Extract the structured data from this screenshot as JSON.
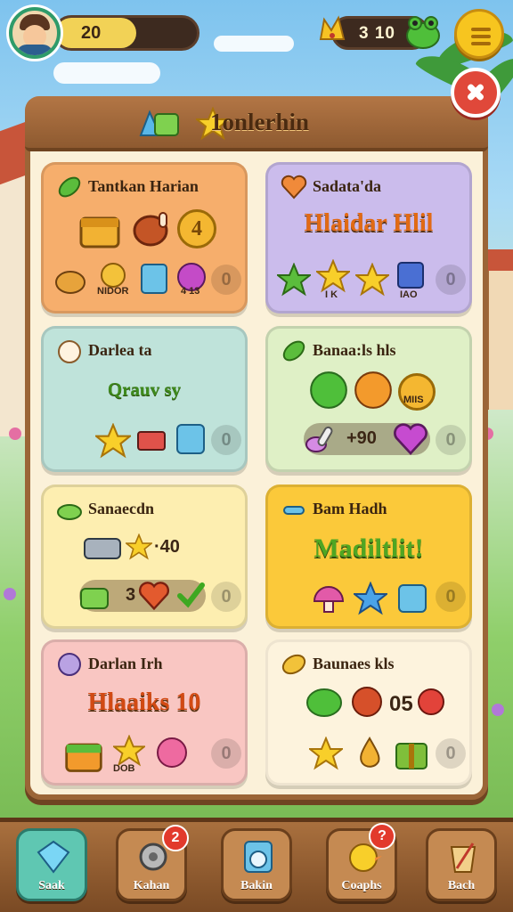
{
  "hud": {
    "level": "20",
    "coins": "3 10"
  },
  "panel": {
    "title": "1onlerhin"
  },
  "cards": [
    {
      "title": "Tantkan Harian",
      "items": [
        "NIDOR",
        "",
        "4 13"
      ],
      "value": "4",
      "slot": "0",
      "color": "#f6ae6c"
    },
    {
      "title": "Sadata'da",
      "headline": "Hlaidar Hlil",
      "items": [
        "I K",
        "",
        "IAO"
      ],
      "slot": "0",
      "color": "#cbbcec"
    },
    {
      "title": "Darlea ta",
      "subline": "Qrauv sy",
      "slot": "0",
      "color": "#bfe3da"
    },
    {
      "title": "Banaa:ls hls",
      "items": [
        "MIIS"
      ],
      "pill_value": "+90",
      "slot": "0",
      "color": "#dff0c6"
    },
    {
      "title": "Sanaecdn",
      "value": "40",
      "pill_value": "3",
      "slot": "0",
      "color": "#fdeeb0"
    },
    {
      "title": "Bam Hadh",
      "headline": "Madiltlit!",
      "slot": "0",
      "color": "#fbc93a"
    },
    {
      "title": "Darlan Irh",
      "headline": "Hlaaiks 10",
      "items": [
        "DOB"
      ],
      "slot": "0",
      "color": "#f9c6c2"
    },
    {
      "title": "Baunaes kls",
      "value": "05",
      "slot": "0",
      "color": "#fdf3dd"
    }
  ],
  "nav": [
    {
      "label": "Saak",
      "badge": ""
    },
    {
      "label": "Kahan",
      "badge": "2"
    },
    {
      "label": "Bakin",
      "badge": ""
    },
    {
      "label": "Coaphs",
      "badge": "?"
    },
    {
      "label": "Bach",
      "badge": ""
    }
  ],
  "colors": {
    "panel_bg": "#fbf1d9",
    "wood": "#9b6537",
    "accent_yellow": "#f7c51f",
    "close_red": "#e0483a",
    "active_tab": "#5fc7b2"
  }
}
